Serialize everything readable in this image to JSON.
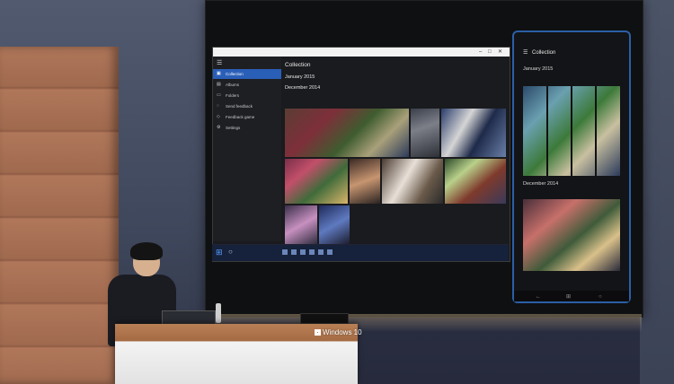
{
  "scene": "Windows 10 keynote stage with presenter and projection screen",
  "desktop": {
    "nav_items": [
      "Collection",
      "Albums",
      "Folders",
      "Send feedback",
      "Feedback game",
      "Settings"
    ],
    "content_title": "Collection",
    "month_1": "January 2015",
    "month_2": "December 2014"
  },
  "phone": {
    "title": "Collection",
    "month_1": "January 2015",
    "month_2": "December 2014"
  },
  "lectern": {
    "logo_text": "Windows 10"
  },
  "colors": {
    "accent": "#2a5fb8",
    "phone_border": "#2b5fa6",
    "taskbar": "#16213b"
  },
  "icons": [
    "hamburger-menu-icon",
    "windows-start-icon",
    "search-icon",
    "window-close-icon",
    "windows-logo-icon"
  ]
}
